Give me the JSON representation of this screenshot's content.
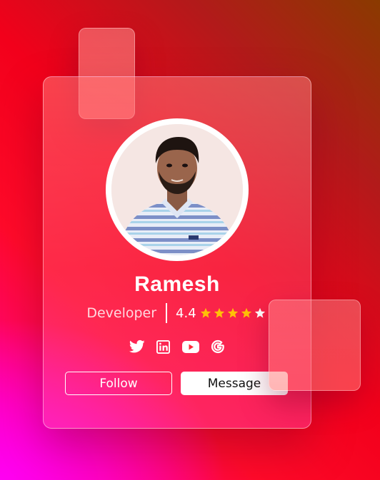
{
  "profile": {
    "name": "Ramesh",
    "role": "Developer",
    "rating_text": "4.4",
    "rating_value": 4.4,
    "rating_max": 5,
    "star_color": "#ffc107",
    "empty_star_color": "#ffffff"
  },
  "social_icons": [
    "twitter-icon",
    "linkedin-icon",
    "youtube-icon",
    "google-icon"
  ],
  "actions": {
    "follow_label": "Follow",
    "message_label": "Message"
  },
  "colors": {
    "background_top_right": "#8a3a00",
    "background_center": "#f2001b",
    "background_bottom_left": "#ff00f2",
    "card_text": "#ffffff",
    "message_button_text": "#111111"
  }
}
